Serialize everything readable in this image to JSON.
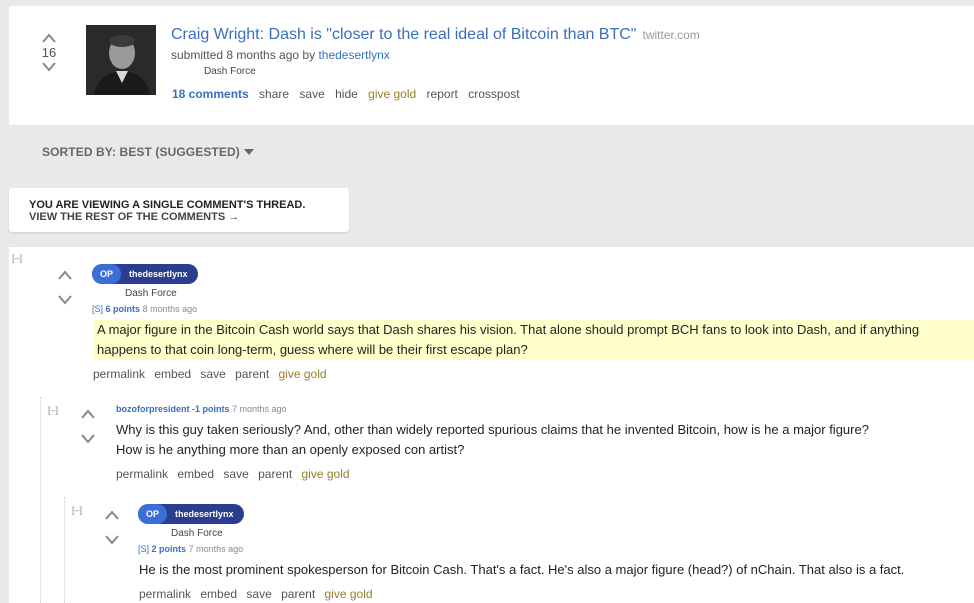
{
  "post": {
    "score": "16",
    "title": "Craig Wright: Dash is \"closer to the real ideal of Bitcoin than BTC\"",
    "domain": "twitter.com",
    "submitted_prefix": "submitted 8 months ago by",
    "author": "thedesertlynx",
    "flair": "Dash Force",
    "actions": {
      "comments": "18 comments",
      "share": "share",
      "save": "save",
      "hide": "hide",
      "give_gold": "give gold",
      "report": "report",
      "crosspost": "crosspost"
    }
  },
  "sort": {
    "label": "SORTED BY: BEST (SUGGESTED)"
  },
  "single_thread": {
    "line1": "YOU ARE VIEWING A SINGLE COMMENT'S THREAD.",
    "line2": "VIEW THE REST OF THE COMMENTS →"
  },
  "comments": [
    {
      "collapse": "[–]",
      "op_badge": "OP",
      "author": "thedesertlynx",
      "flair": "Dash Force",
      "submitter_tag": "[S]",
      "points": "6 points",
      "age": "8 months ago",
      "body": "A major figure in the Bitcoin Cash world says that Dash shares his vision. That alone should prompt BCH fans to look into Dash, and if anything happens to that coin long-term, guess where will be their first escape plan?",
      "actions": {
        "permalink": "permalink",
        "embed": "embed",
        "save": "save",
        "parent": "parent",
        "give_gold": "give gold"
      }
    },
    {
      "collapse": "[–]",
      "author": "bozoforpresident",
      "points": "-1 points",
      "age": "7 months ago",
      "body_line1": "Why is this guy taken seriously? And, other than widely reported spurious claims that he invented Bitcoin, how is he a major figure?",
      "body_line2": "How is he anything more than an openly exposed con artist?",
      "actions": {
        "permalink": "permalink",
        "embed": "embed",
        "save": "save",
        "parent": "parent",
        "give_gold": "give gold"
      }
    },
    {
      "collapse": "[–]",
      "op_badge": "OP",
      "author": "thedesertlynx",
      "flair": "Dash Force",
      "submitter_tag": "[S]",
      "points": "2 points",
      "age": "7 months ago",
      "body": "He is the most prominent spokesperson for Bitcoin Cash. That's a fact. He's also a major figure (head?) of nChain. That also is a fact.",
      "actions": {
        "permalink": "permalink",
        "embed": "embed",
        "save": "save",
        "parent": "parent",
        "give_gold": "give gold"
      }
    }
  ],
  "icons": {
    "upvote": "upvote-arrow-icon",
    "downvote": "downvote-arrow-icon",
    "sort_caret": "caret-down-icon"
  }
}
